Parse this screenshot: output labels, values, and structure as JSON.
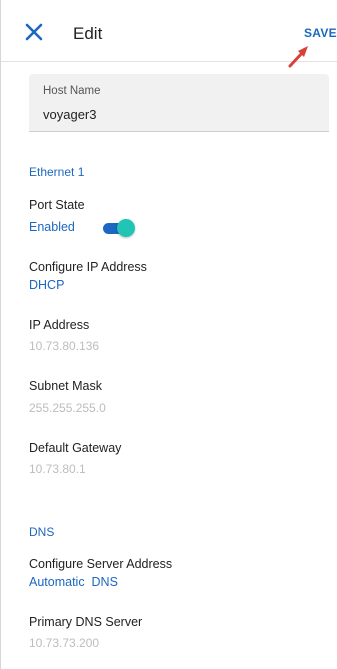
{
  "header": {
    "title": "Edit",
    "save_label": "SAVE",
    "close_icon": "close-icon",
    "accent_color": "#1b67c1",
    "annotation_arrow_color": "#d9403a"
  },
  "host": {
    "label": "Host Name",
    "value": "voyager3"
  },
  "ethernet": {
    "section_title": "Ethernet 1",
    "port_state": {
      "label": "Port State",
      "value": "Enabled",
      "toggle_on": true
    },
    "configure_ip": {
      "label": "Configure IP Address",
      "value": "DHCP"
    },
    "ip_address": {
      "label": "IP Address",
      "value": "10.73.80.136"
    },
    "subnet_mask": {
      "label": "Subnet Mask",
      "value": "255.255.255.0"
    },
    "default_gateway": {
      "label": "Default Gateway",
      "value": "10.73.80.1"
    }
  },
  "dns": {
    "section_title": "DNS",
    "configure_server": {
      "label": "Configure Server Address",
      "value": "Automatic  DNS"
    },
    "primary_server": {
      "label": "Primary DNS Server",
      "value": "10.73.73.200"
    }
  }
}
